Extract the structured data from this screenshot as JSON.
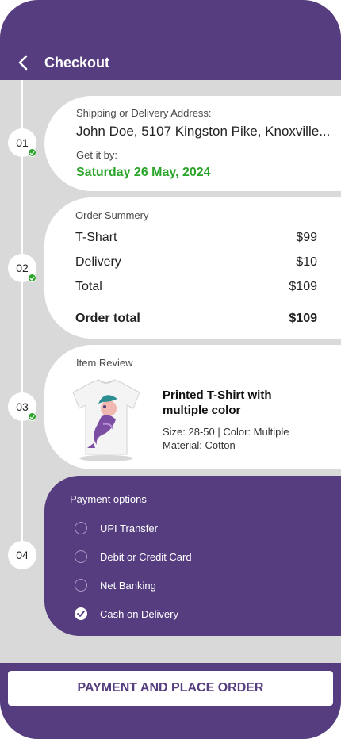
{
  "header": {
    "title": "Checkout",
    "back_icon": "chevron-left-icon"
  },
  "steps": [
    {
      "number": "01",
      "completed": true
    },
    {
      "number": "02",
      "completed": true
    },
    {
      "number": "03",
      "completed": true
    },
    {
      "number": "04",
      "completed": false
    }
  ],
  "shipping": {
    "address_label": "Shipping or Delivery Address:",
    "address": "John Doe, 5107 Kingston Pike, Knoxville...",
    "eta_label": "Get it by:",
    "eta_date": "Saturday 26 May, 2024"
  },
  "summary": {
    "title": "Order Summery",
    "lines": [
      {
        "label": "T-Shart",
        "value": "$99"
      },
      {
        "label": "Delivery",
        "value": "$10"
      },
      {
        "label": "Total",
        "value": "$109"
      }
    ],
    "order_total_label": "Order total",
    "order_total_value": "$109"
  },
  "item_review": {
    "title": "Item Review",
    "product_name": "Printed T-Shirt  with multiple color",
    "specs": "Size: 28-50 | Color: Multiple",
    "material": "Material: Cotton"
  },
  "payment": {
    "title": "Payment options",
    "options": [
      {
        "label": "UPI Transfer",
        "selected": false
      },
      {
        "label": "Debit or Credit Card",
        "selected": false
      },
      {
        "label": "Net Banking",
        "selected": false
      },
      {
        "label": "Cash on Delivery",
        "selected": true
      }
    ]
  },
  "footer": {
    "button_label": "PAYMENT AND PLACE ORDER"
  },
  "colors": {
    "brand": "#553d80",
    "success": "#2aa52a",
    "background": "#d9d9d9"
  }
}
